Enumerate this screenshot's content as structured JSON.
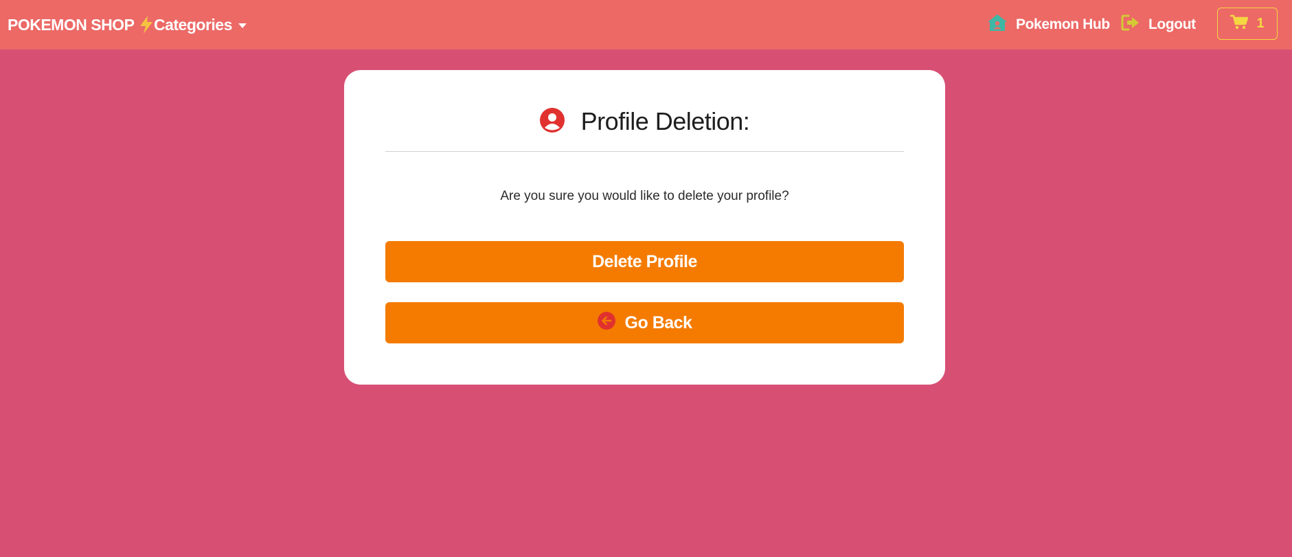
{
  "navbar": {
    "brand": "POKEMON SHOP",
    "brand_icon": "lightning-bolt-icon",
    "categories_label": "Categories",
    "hub_label": "Pokemon Hub",
    "hub_icon": "house-user-icon",
    "logout_label": "Logout",
    "logout_icon": "sign-out-icon",
    "cart_count": "1",
    "cart_icon": "shopping-cart-icon"
  },
  "card": {
    "title": "Profile Deletion:",
    "title_icon": "user-circle-icon",
    "question": "Are you sure you would like to delete your profile?",
    "delete_label": "Delete Profile",
    "back_label": "Go Back",
    "back_icon": "arrow-circle-left-icon"
  },
  "colors": {
    "page_background": "#d75074",
    "navbar_background": "#ec6966",
    "button_orange": "#f47b00",
    "accent_yellow": "#f5d742",
    "icon_red": "#e0312f",
    "icon_teal": "#3fb6a4"
  }
}
